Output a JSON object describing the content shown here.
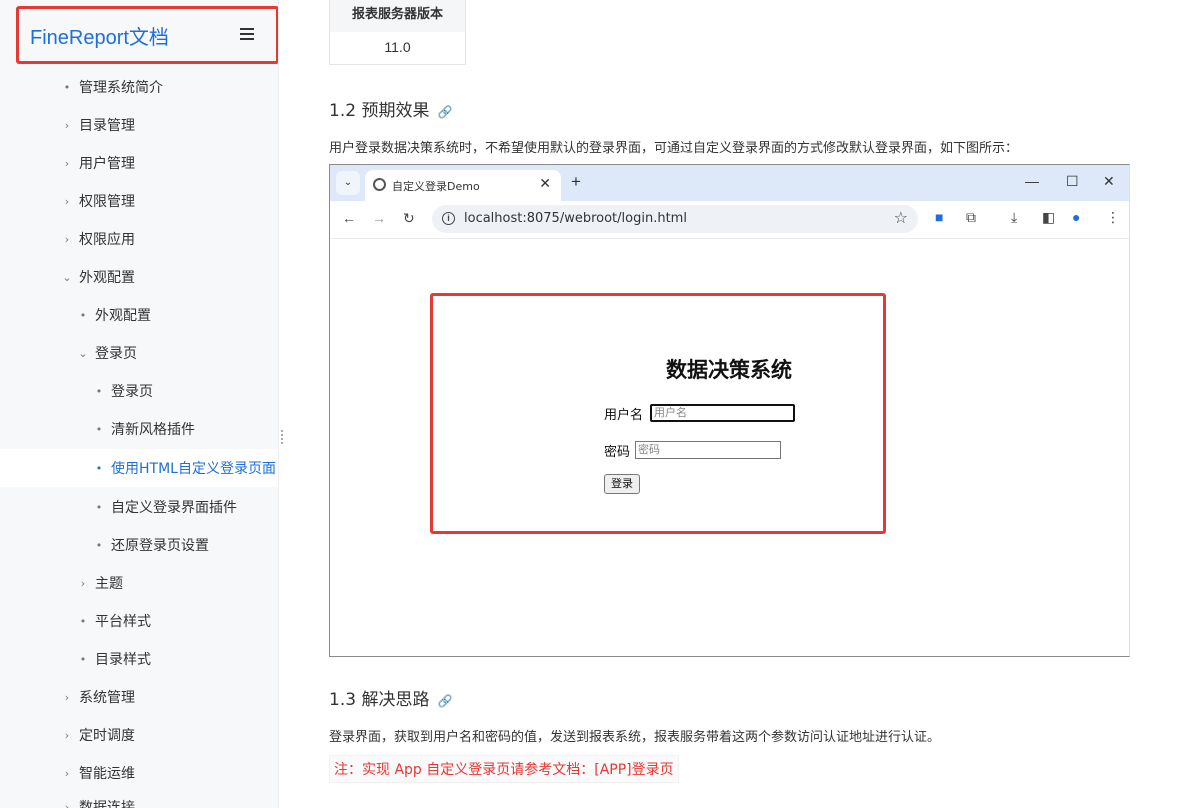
{
  "sidebar": {
    "logo": "FineReport文档",
    "items": [
      {
        "label": "管理系统简介",
        "marker": "•"
      },
      {
        "label": "目录管理",
        "marker": "›"
      },
      {
        "label": "用户管理",
        "marker": "›"
      },
      {
        "label": "权限管理",
        "marker": "›"
      },
      {
        "label": "权限应用",
        "marker": "›"
      },
      {
        "label": "外观配置",
        "marker": "⌄"
      },
      {
        "label": "外观配置",
        "marker": "•"
      },
      {
        "label": "登录页",
        "marker": "⌄"
      },
      {
        "label": "登录页",
        "marker": "•"
      },
      {
        "label": "清新风格插件",
        "marker": "•"
      },
      {
        "label": "使用HTML自定义登录页面",
        "marker": "•"
      },
      {
        "label": "自定义登录界面插件",
        "marker": "•"
      },
      {
        "label": "还原登录页设置",
        "marker": "•"
      },
      {
        "label": "主题",
        "marker": "›"
      },
      {
        "label": "平台样式",
        "marker": "•"
      },
      {
        "label": "目录样式",
        "marker": "•"
      },
      {
        "label": "系统管理",
        "marker": "›"
      },
      {
        "label": "定时调度",
        "marker": "›"
      },
      {
        "label": "智能运维",
        "marker": "›"
      },
      {
        "label": "数据连接",
        "marker": "›"
      }
    ]
  },
  "content": {
    "version_table": {
      "header": "报表服务器版本",
      "value": "11.0"
    },
    "section_1_2": {
      "title": "1.2 预期效果",
      "link_icon": "🔗"
    },
    "para_1": "用户登录数据决策系统时，不希望使用默认的登录界面，可通过自定义登录界面的方式修改默认登录界面，如下图所示：",
    "section_1_3": {
      "title": "1.3 解决思路",
      "link_icon": "🔗"
    },
    "para_2": "登录界面，获取到用户名和密码的值，发送到报表系统，报表服务带着这两个参数访问认证地址进行认证。",
    "note": "注：实现 App 自定义登录页请参考文档：[APP]登录页"
  },
  "browser": {
    "tab_title": "自定义登录Demo",
    "url": "localhost:8075/webroot/login.html",
    "page": {
      "title": "数据决策系统",
      "username_label": "用户名",
      "username_placeholder": "用户名",
      "password_label": "密码",
      "password_placeholder": "密码",
      "login_button": "登录"
    }
  },
  "colors": {
    "accent": "#1e6fd9",
    "highlight": "#e53935",
    "sidebar_bg": "#f7f8fa",
    "tabbar_bg": "#dde8f9"
  }
}
